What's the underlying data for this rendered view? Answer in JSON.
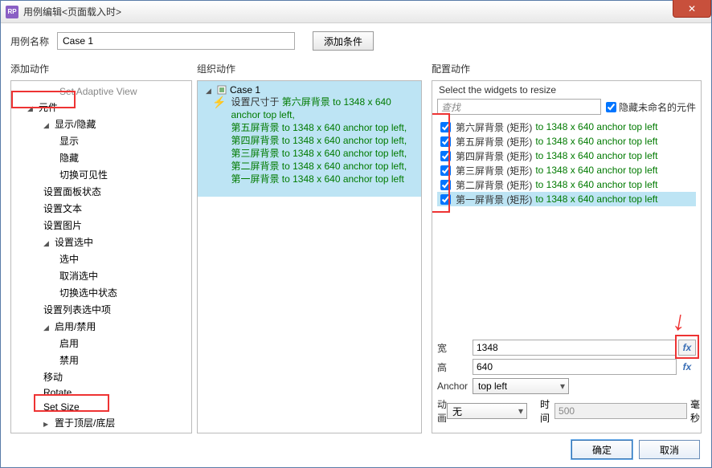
{
  "window": {
    "title": "用例编辑<页面载入时>"
  },
  "nameRow": {
    "label": "用例名称",
    "value": "Case 1",
    "addCondition": "添加条件"
  },
  "cols": {
    "c1": "添加动作",
    "c2": "组织动作",
    "c3": "配置动作"
  },
  "tree": {
    "adaptive": "Set Adaptive View",
    "widgets": "元件",
    "showhide": "显示/隐藏",
    "show": "显示",
    "hide": "隐藏",
    "toggle": "切换可见性",
    "panelstate": "设置面板状态",
    "settext": "设置文本",
    "setimage": "设置图片",
    "selgroup": "设置选中",
    "sel": "选中",
    "unsel": "取消选中",
    "togsel": "切换选中状态",
    "listsel": "设置列表选中项",
    "enabledisable": "启用/禁用",
    "enable": "启用",
    "disable": "禁用",
    "move": "移动",
    "rotate": "Rotate",
    "setsize": "Set Size",
    "bringfront": "置于顶层/底层"
  },
  "org": {
    "caseName": "Case 1",
    "prefix": "设置尺寸于 ",
    "lines": [
      "第六屏背景 to 1348 x 640 anchor top left,",
      "第五屏背景 to 1348 x 640 anchor top left,",
      "第四屏背景 to 1348 x 640 anchor top left,",
      "第三屏背景 to 1348 x 640 anchor top left,",
      "第二屏背景 to 1348 x 640 anchor top left,",
      "第一屏背景 to 1348 x 640 anchor top left"
    ]
  },
  "cfg": {
    "header": "Select the widgets to resize",
    "searchPlaceholder": "查找",
    "hideUnnamed": "隐藏未命名的元件",
    "items": [
      {
        "name": "第六屏背景 (矩形)",
        "size": "to 1348 x 640 anchor top left"
      },
      {
        "name": "第五屏背景 (矩形)",
        "size": "to 1348 x 640 anchor top left"
      },
      {
        "name": "第四屏背景 (矩形)",
        "size": "to 1348 x 640 anchor top left"
      },
      {
        "name": "第三屏背景 (矩形)",
        "size": "to 1348 x 640 anchor top left"
      },
      {
        "name": "第二屏背景 (矩形)",
        "size": "to 1348 x 640 anchor top left"
      },
      {
        "name": "第一屏背景 (矩形)",
        "size": "to 1348 x 640 anchor top left"
      }
    ],
    "wLabel": "宽",
    "wVal": "1348",
    "hLabel": "高",
    "hVal": "640",
    "anchorLabel": "Anchor",
    "anchorVal": "top left",
    "animLabel": "动画",
    "animVal": "无",
    "timeLabel": "时间",
    "timeVal": "500",
    "msLabel": "毫秒"
  },
  "buttons": {
    "ok": "确定",
    "cancel": "取消"
  }
}
